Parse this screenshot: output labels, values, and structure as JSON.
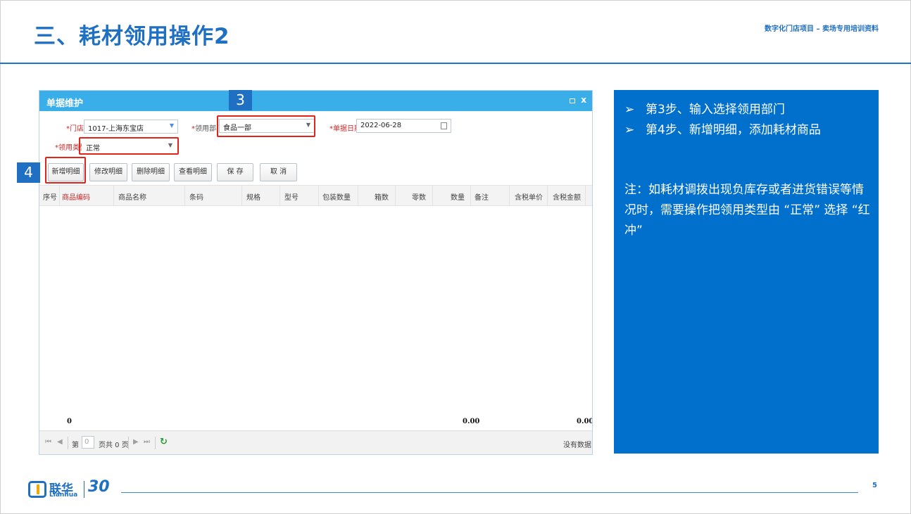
{
  "slide": {
    "title": "三、耗材领用操作2",
    "subtitle": "数字化门店项目 – 卖场专用培训资料",
    "page_number": "5"
  },
  "window": {
    "title": "单据维护",
    "close_glyph": "x"
  },
  "form": {
    "store_label": "*门店:",
    "store_value": "1017-上海东宝店",
    "dept_label": "*领用部门",
    "dept_value": "食品一部",
    "date_label": "*单据日期:",
    "date_value": "2022-06-28",
    "type_label": "*领用类型:",
    "type_value": "正常"
  },
  "toolbar": {
    "add_detail": "新增明细",
    "edit_detail": "修改明细",
    "delete_detail": "删除明细",
    "view_detail": "查看明细",
    "save": "保 存",
    "cancel": "取 消"
  },
  "grid": {
    "columns": [
      "序号",
      "商品编码",
      "商品名称",
      "条码",
      "规格",
      "型号",
      "包装数量",
      "箱数",
      "零数",
      "数量",
      "备注",
      "含税单价",
      "含税金额"
    ],
    "summary": {
      "count": "0",
      "quantity": "0.00",
      "amount": "0.00"
    }
  },
  "pager": {
    "page_prefix": "第",
    "page_value": "0",
    "page_suffix": "页共 0 页",
    "no_data": "没有数据"
  },
  "badges": {
    "step3": "3",
    "step4": "4"
  },
  "note": {
    "step3": "第3步、输入选择领用部门",
    "step4": "第4步、新增明细，添加耗材商品",
    "remark": "注：如耗材调拨出现负库存或者进货错误等情况时，需要操作把领用类型由 “正常” 选择 “红冲”"
  },
  "logo": {
    "cn": "联华",
    "en": "Lianhua",
    "anniversary": "30"
  },
  "colors": {
    "brand_blue": "#1f6fc3",
    "window_header": "#3aaee9",
    "note_panel": "#0070cc",
    "highlight_red": "#e2231a"
  }
}
